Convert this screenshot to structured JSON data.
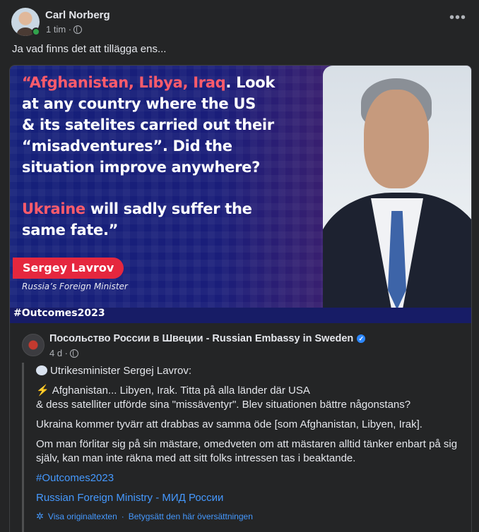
{
  "post": {
    "author": "Carl Norberg",
    "time": "1 tim ·",
    "more_icon": "•••",
    "text": "Ja vad finns det att tillägga ens..."
  },
  "image": {
    "quote_l1_hl": "“Afghanistan, Libya, Iraq",
    "quote_l1_rest": ". Look",
    "quote_l2": "at any country where the US",
    "quote_l3": "& its satelites carried out their",
    "quote_l4": "“misadventures”. Did the",
    "quote_l5": "situation improve anywhere?",
    "quote_l6_hl": "Ukraine",
    "quote_l6_rest": " will sadly suffer the",
    "quote_l7": "same fate.”",
    "speaker": "Sergey Lavrov",
    "speaker_title": "Russia’s Foreign Minister",
    "hashtag": "#Outcomes2023"
  },
  "shared": {
    "page_name": "Посольство России в Швеции - Russian Embassy in Sweden",
    "verified": "✓",
    "time": "4 d ·",
    "intro": "Utrikesminister Sergej Lavrov:",
    "bolt": "⚡",
    "para1_l1": "Afghanistan... Libyen, Irak. Titta på alla länder där USA",
    "para1_l2": "& dess satelliter utförde sina \"missäventyr\". Blev situationen bättre någonstans?",
    "para2": "Ukraina kommer tyvärr att drabbas av samma öde [som Afghanistan, Libyen, Irak].",
    "para3": "Om man förlitar sig på sin mästare, omedveten om att mästaren alltid tänker enbart på sig själv, kan man inte räkna med att sitt folks intressen tas i beaktande.",
    "hashtag_link": "#Outcomes2023",
    "ministry_link": "Russian Foreign Ministry - МИД России",
    "translate_icon": "✲",
    "see_original": "Visa originaltexten",
    "rate_translation": "Betygsätt den här översättningen",
    "dot": " · "
  }
}
